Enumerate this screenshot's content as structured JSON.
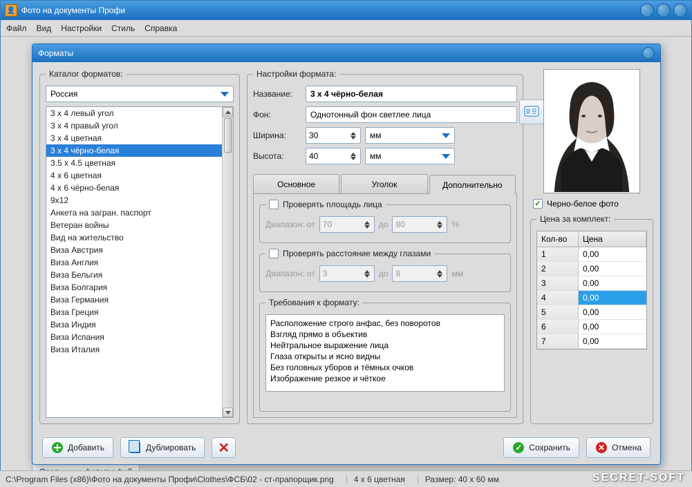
{
  "app": {
    "title": "Фото на документы Профи"
  },
  "menu": {
    "file": "Файл",
    "view": "Вид",
    "settings": "Настройки",
    "style": "Стиль",
    "help": "Справка"
  },
  "dialog": {
    "title": "Форматы",
    "catalog": {
      "legend": "Каталог форматов:",
      "country": "Россия",
      "items": [
        "3 x 4 левый угол",
        "3 x 4 правый угол",
        "3 x 4 цветная",
        "3 x 4 чёрно-белая",
        "3.5 x 4.5 цветная",
        "4 x 6 цветная",
        "4 x 6 чёрно-белая",
        "9x12",
        "Анкета на загран. паспорт",
        "Ветеран войны",
        "Вид на жительство",
        "Виза Австрия",
        "Виза Англия",
        "Виза Бельгия",
        "Виза Болгария",
        "Виза Германия",
        "Виза Греция",
        "Виза Индия",
        "Виза Испания",
        "Виза Италия"
      ],
      "selected_index": 3
    },
    "settings": {
      "legend": "Настройки формата:",
      "name_label": "Название:",
      "name_value": "3 х 4 чёрно-белая",
      "bg_label": "Фон:",
      "bg_value": "Однотонный фон светлее лица",
      "width_label": "Ширина:",
      "width_value": "30",
      "height_label": "Высота:",
      "height_value": "40",
      "unit": "мм",
      "tabs": {
        "main": "Основное",
        "corner": "Уголок",
        "extra": "Дополнительно"
      },
      "check_face_area": {
        "label": "Проверять площадь лица",
        "range_label": "Диапазон: от",
        "from": "70",
        "to_label": "до",
        "to": "80",
        "unit": "%"
      },
      "check_eye_dist": {
        "label": "Проверять расстояние между глазами",
        "range_label": "Диапазон: от",
        "from": "3",
        "to_label": "до",
        "to": "8",
        "unit": "мм"
      },
      "requirements": {
        "legend": "Требования к формату:",
        "items": [
          "Расположение строго анфас, без поворотов",
          "Взгляд прямо в объектив",
          "Нейтральное выражение лица",
          "Глаза открыты и ясно видны",
          "Без головных уборов и тёмных очков",
          "Изображение резкое и чёткое"
        ]
      }
    },
    "right": {
      "bw_label": "Черно-белое фото",
      "price": {
        "legend": "Цена за комплект:",
        "col_qty": "Кол-во",
        "col_price": "Цена",
        "rows": [
          {
            "q": "1",
            "p": "0,00"
          },
          {
            "q": "2",
            "p": "0,00"
          },
          {
            "q": "3",
            "p": "0,00"
          },
          {
            "q": "4",
            "p": "0,00"
          },
          {
            "q": "5",
            "p": "0,00"
          },
          {
            "q": "6",
            "p": "0,00"
          },
          {
            "q": "7",
            "p": "0,00"
          }
        ],
        "selected_index": 3
      }
    },
    "buttons": {
      "add": "Добавить",
      "dup": "Дублировать",
      "save": "Сохранить",
      "cancel": "Отмена"
    }
  },
  "bg": {
    "compare": "Сравнение фотографий"
  },
  "status": {
    "path": "C:\\Program Files (x86)\\Фото на документы Профи\\Clothes\\ФСБ\\02 - ст-прапорщик.png",
    "format": "4 x 6 цветная",
    "size": "Размер: 40 x 60 мм"
  },
  "watermark": "SECRET-SOFT"
}
